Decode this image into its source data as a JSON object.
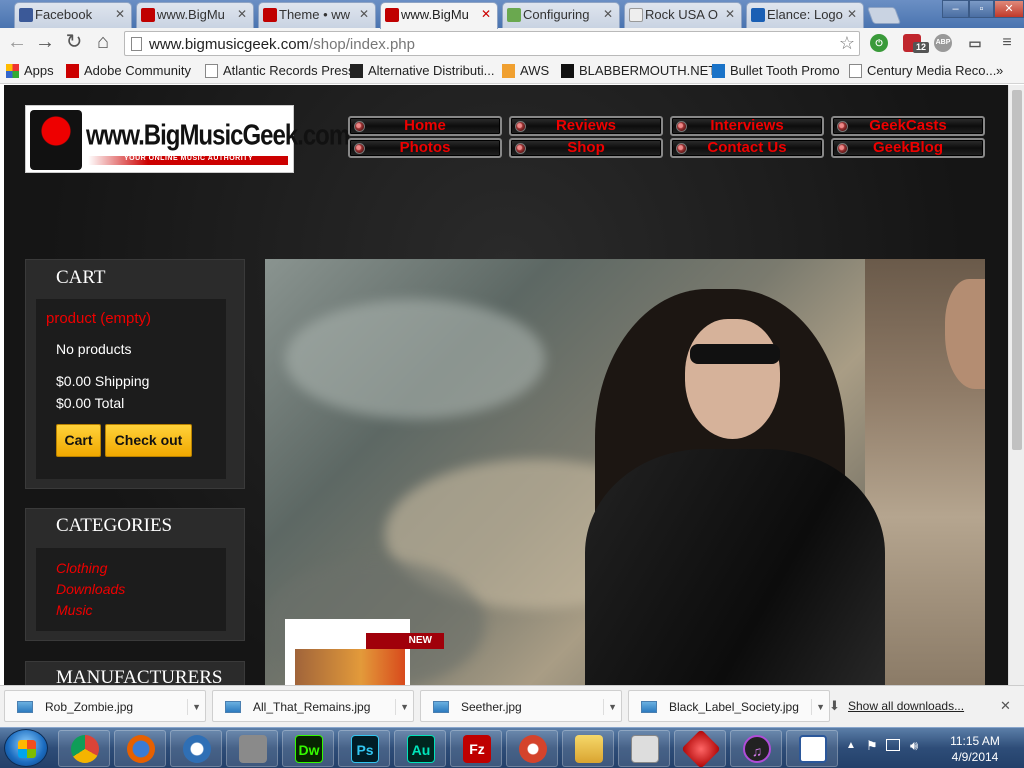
{
  "browser": {
    "tabs": [
      {
        "title": "Facebook",
        "favicon_color": "#3b5998"
      },
      {
        "title": "www.BigMu",
        "favicon_color": "#c00000"
      },
      {
        "title": "Theme • ww",
        "favicon_color": "#c00000"
      },
      {
        "title": "www.BigMu",
        "favicon_color": "#c00000",
        "active": true
      },
      {
        "title": "Configuring",
        "favicon_color": "#6aa84f"
      },
      {
        "title": "Rock USA O",
        "favicon_color": "#999999"
      },
      {
        "title": "Elance: Logo",
        "favicon_color": "#1a5fb4"
      }
    ],
    "window_buttons": {
      "minimize": "–",
      "maximize": "▫",
      "close": "✕"
    },
    "url": {
      "host": "www.bigmusicgeek.com",
      "path": "/shop/index.php"
    },
    "extension_badge": "12",
    "abp_label": "ABP",
    "bookmarks": [
      {
        "label": "Apps",
        "icon": "apps-grid-icon"
      },
      {
        "label": "Adobe Community",
        "icon": "adobe-icon"
      },
      {
        "label": "Atlantic Records Press",
        "icon": "page-icon"
      },
      {
        "label": "Alternative Distributi...",
        "icon": "ada-icon"
      },
      {
        "label": "AWS",
        "icon": "aws-icon"
      },
      {
        "label": "BLABBERMOUTH.NET",
        "icon": "blabbermouth-icon"
      },
      {
        "label": "Bullet Tooth Promo",
        "icon": "info-icon"
      },
      {
        "label": "Century Media Reco...",
        "icon": "page-icon"
      }
    ],
    "overflow": "»"
  },
  "site": {
    "logo_text": "www.BigMusicGeek.com",
    "logo_tagline": "YOUR ONLINE MUSIC AUTHORITY",
    "nav": [
      "Home",
      "Reviews",
      "Interviews",
      "GeekCasts",
      "Photos",
      "Shop",
      "Contact Us",
      "GeekBlog"
    ],
    "cart": {
      "title": "CART",
      "product_status": "product (empty)",
      "no_products": "No products",
      "shipping": "$0.00 Shipping",
      "total": "$0.00 Total",
      "cart_button": "Cart",
      "checkout_button": "Check out"
    },
    "categories": {
      "title": "CATEGORIES",
      "items": [
        "Clothing",
        "Downloads",
        "Music"
      ]
    },
    "manufacturers_title": "MANUFACTURERS",
    "new_badge": "NEW"
  },
  "downloads": {
    "files": [
      "Rob_Zombie.jpg",
      "All_That_Remains.jpg",
      "Seether.jpg",
      "Black_Label_Society.jpg"
    ],
    "show_all": "Show all downloads...",
    "close": "✕"
  },
  "taskbar": {
    "apps": [
      {
        "name": "chrome",
        "label": "",
        "color": "#e8453c"
      },
      {
        "name": "firefox",
        "label": "",
        "color": "#e66000"
      },
      {
        "name": "thunderbird",
        "label": "",
        "color": "#2f6fb5"
      },
      {
        "name": "file-manager",
        "label": "",
        "color": "#8a8a8a"
      },
      {
        "name": "dreamweaver",
        "label": "Dw",
        "color": "#35fa00"
      },
      {
        "name": "photoshop",
        "label": "Ps",
        "color": "#31c5f0"
      },
      {
        "name": "audition",
        "label": "Au",
        "color": "#00e4bb"
      },
      {
        "name": "filezilla",
        "label": "Fz",
        "color": "#bf0000"
      },
      {
        "name": "ccleaner",
        "label": "",
        "color": "#d4432c"
      },
      {
        "name": "explorer",
        "label": "",
        "color": "#f0c040"
      },
      {
        "name": "clipboard",
        "label": "",
        "color": "#dddddd"
      },
      {
        "name": "app-red",
        "label": "",
        "color": "#d22"
      },
      {
        "name": "itunes",
        "label": "♫",
        "color": "#b04cd8"
      },
      {
        "name": "word",
        "label": "",
        "color": "#2b579a"
      }
    ],
    "time": "11:15 AM",
    "date": "4/9/2014"
  }
}
